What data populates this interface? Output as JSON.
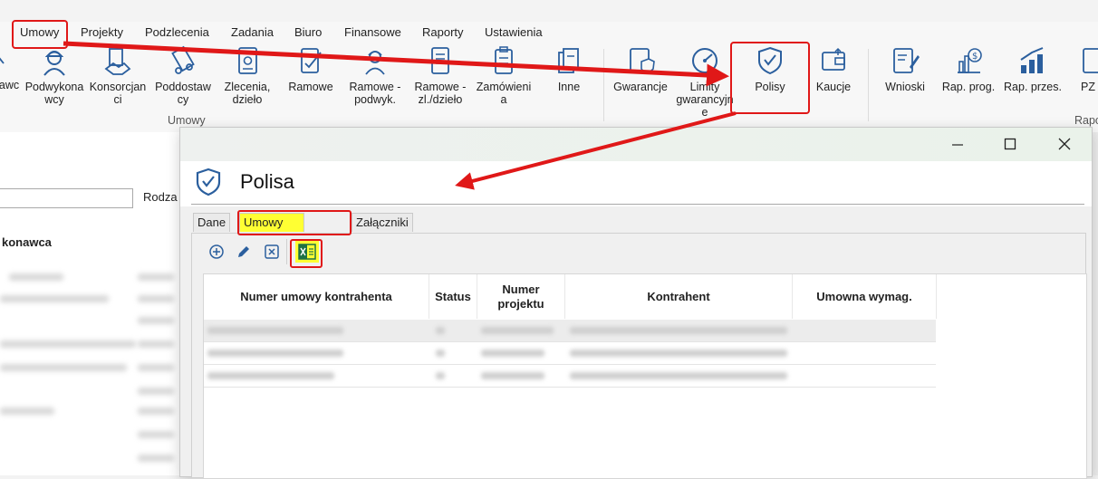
{
  "menu": {
    "items": [
      "Umowy",
      "Projekty",
      "Podzlecenia",
      "Zadania",
      "Biuro",
      "Finansowe",
      "Raporty",
      "Ustawienia"
    ]
  },
  "ribbon": {
    "buttons": [
      {
        "label": "awc",
        "icon": "doc-icon"
      },
      {
        "label": "Podwykona\nwcy",
        "icon": "worker-icon"
      },
      {
        "label": "Konsorcjan\nci",
        "icon": "handshake-icon"
      },
      {
        "label": "Poddostaw\ncy",
        "icon": "truck-icon"
      },
      {
        "label": "Zlecenia,\ndzieło",
        "icon": "contract-icon"
      },
      {
        "label": "Ramowe",
        "icon": "signed-doc-icon"
      },
      {
        "label": "Ramowe -\npodwyk.",
        "icon": "worker-doc-icon"
      },
      {
        "label": "Ramowe -\nzl./dzieło",
        "icon": "frame-doc-icon"
      },
      {
        "label": "Zamówieni\na",
        "icon": "clipboard-icon"
      },
      {
        "label": "Inne",
        "icon": "docs-stack-icon"
      },
      {
        "label": "Gwarancje",
        "icon": "guarantee-icon"
      },
      {
        "label": "Limity\ngwarancyjn\ne",
        "icon": "gauge-icon"
      },
      {
        "label": "Polisy",
        "icon": "shield-check-icon"
      },
      {
        "label": "Kaucje",
        "icon": "wallet-icon"
      },
      {
        "label": "Wnioski",
        "icon": "edit-doc-icon"
      },
      {
        "label": "Rap. prog.",
        "icon": "money-chart-icon"
      },
      {
        "label": "Rap. przes.",
        "icon": "growth-chart-icon"
      },
      {
        "label": "PZ",
        "icon": "doc-icon"
      }
    ],
    "group_umowy": "Umowy",
    "group_rap": "Rapo"
  },
  "left": {
    "label": "Rodza",
    "header": "konawca"
  },
  "dialog": {
    "title": "Polisa",
    "tabs": [
      "Dane",
      "Umowy powiązane",
      "Załączniki"
    ],
    "active_tab": "Umowy powiązane",
    "toolbar": [
      "add-icon",
      "edit-icon",
      "delete-icon",
      "excel-icon"
    ],
    "columns": [
      "Numer umowy kontrahenta",
      "Status",
      "Numer\nprojektu",
      "Kontrahent",
      "Umowna wymag."
    ],
    "row_count": 3
  },
  "colors": {
    "highlight_yellow": "#ffff33",
    "annotation_red": "#e01818",
    "icon_blue": "#2b5f9e",
    "excel_green": "#1e7145"
  }
}
